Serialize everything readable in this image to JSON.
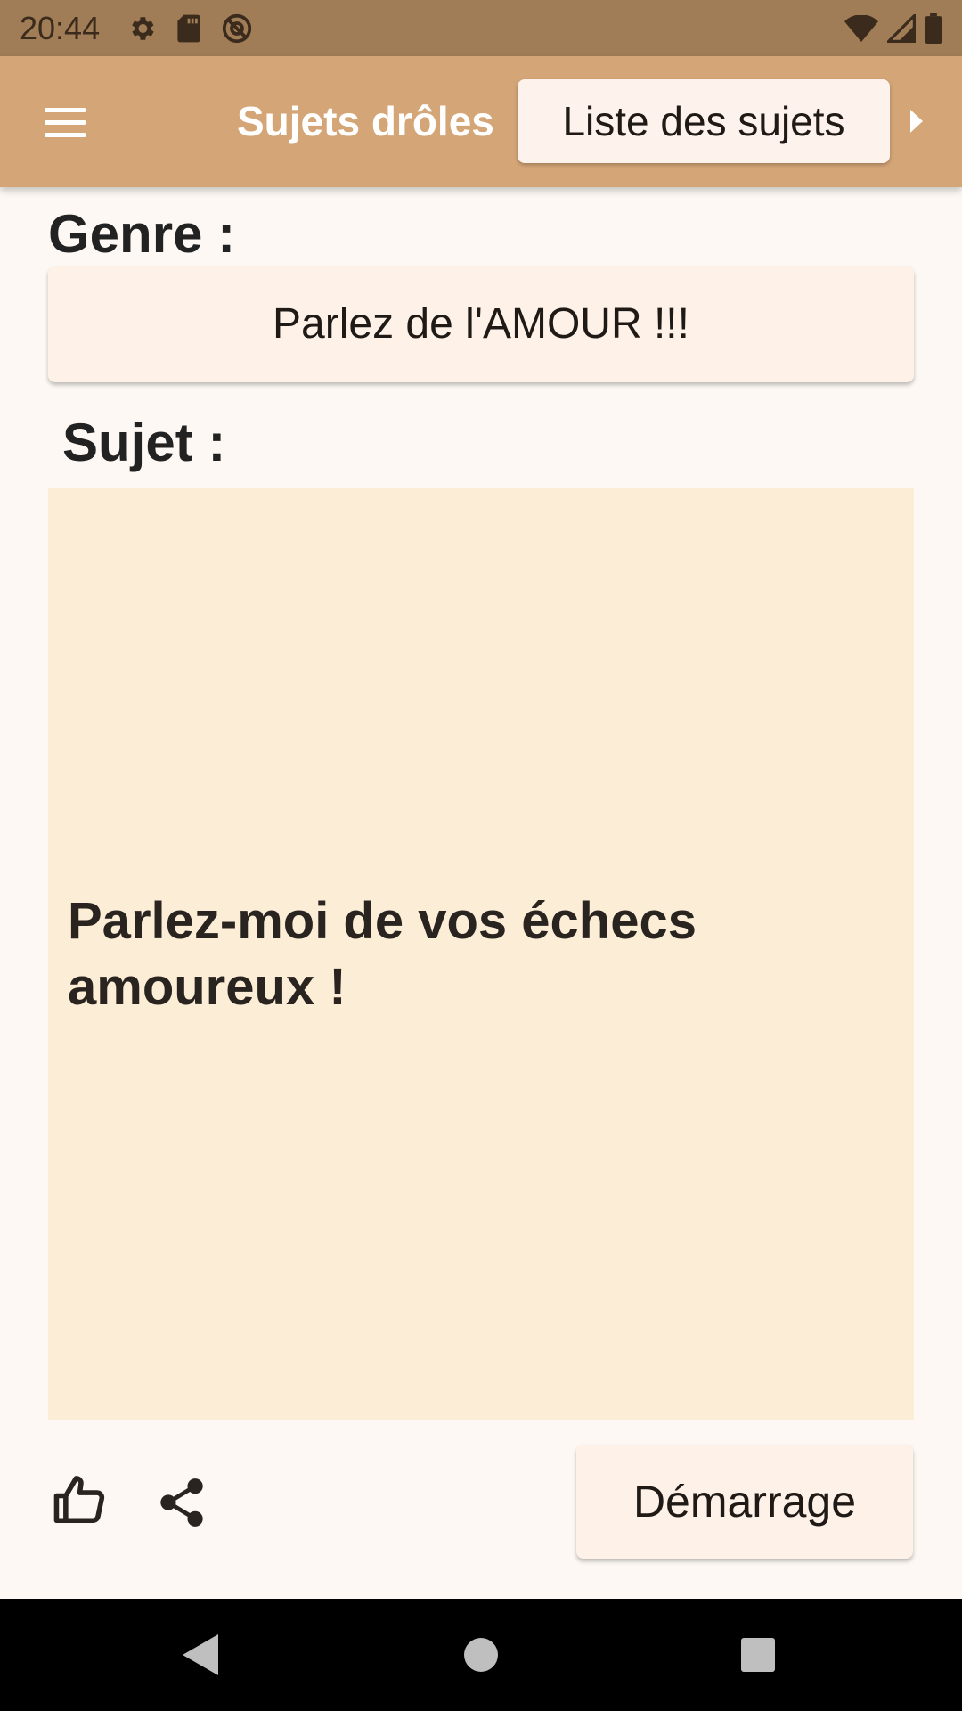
{
  "status_bar": {
    "time": "20:44",
    "icons_left": [
      "settings-icon",
      "sd-card-icon",
      "no-sim-icon"
    ],
    "icons_right": [
      "wifi-icon",
      "signal-icon",
      "battery-icon"
    ]
  },
  "app_bar": {
    "menu_icon": "hamburger-menu-icon",
    "title": "Sujets drôles",
    "list_button_label": "Liste des sujets",
    "more_icon": "arrow-right-icon"
  },
  "main": {
    "genre_label": "Genre :",
    "genre_value": "Parlez de l'AMOUR !!!",
    "subject_label": "Sujet :",
    "subject_text": "Parlez-moi de vos échecs amoureux !"
  },
  "footer": {
    "like_icon": "thumbs-up-icon",
    "share_icon": "share-icon",
    "start_button_label": "Démarrage"
  },
  "nav_bar": {
    "icons": [
      "back-icon",
      "home-icon",
      "recents-icon"
    ]
  },
  "colors": {
    "status_bar": "#a07c57",
    "app_bar": "#d4a577",
    "background": "#fdf8f3",
    "subject_box": "#fcedd6",
    "button": "#fdf1e8"
  }
}
